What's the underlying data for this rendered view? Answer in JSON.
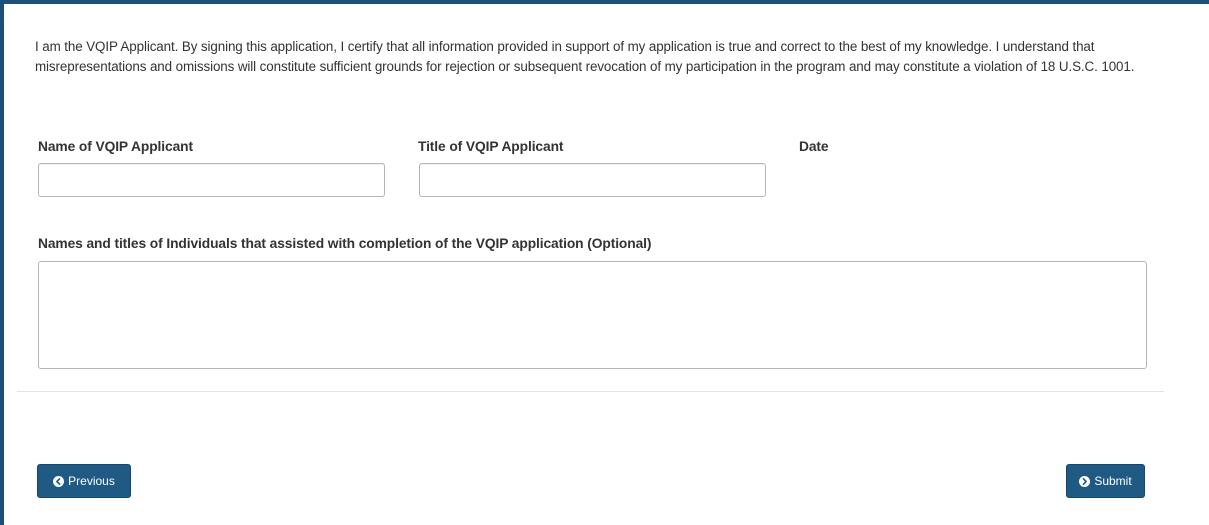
{
  "certification": {
    "text": "I am the VQIP Applicant. By signing this application, I certify that all information provided in support of my application is true and correct to the best of my knowledge. I understand that misrepresentations and omissions will constitute sufficient grounds for rejection or subsequent revocation of my participation in the program and may constitute a violation of 18 U.S.C. 1001."
  },
  "form": {
    "name_label": "Name of VQIP Applicant",
    "name_value": "",
    "title_label": "Title of VQIP Applicant",
    "title_value": "",
    "date_label": "Date",
    "assist_label": "Names and titles of Individuals that assisted with completion of the VQIP application (Optional)",
    "assist_value": ""
  },
  "buttons": {
    "previous_label": "Previous",
    "previous_icon": "chevron-left-circle-icon",
    "submit_label": "Submit",
    "submit_icon": "chevron-right-circle-icon"
  },
  "colors": {
    "frame_border": "#1f4e79",
    "button_bg": "#1f5a85",
    "text": "#333333"
  }
}
